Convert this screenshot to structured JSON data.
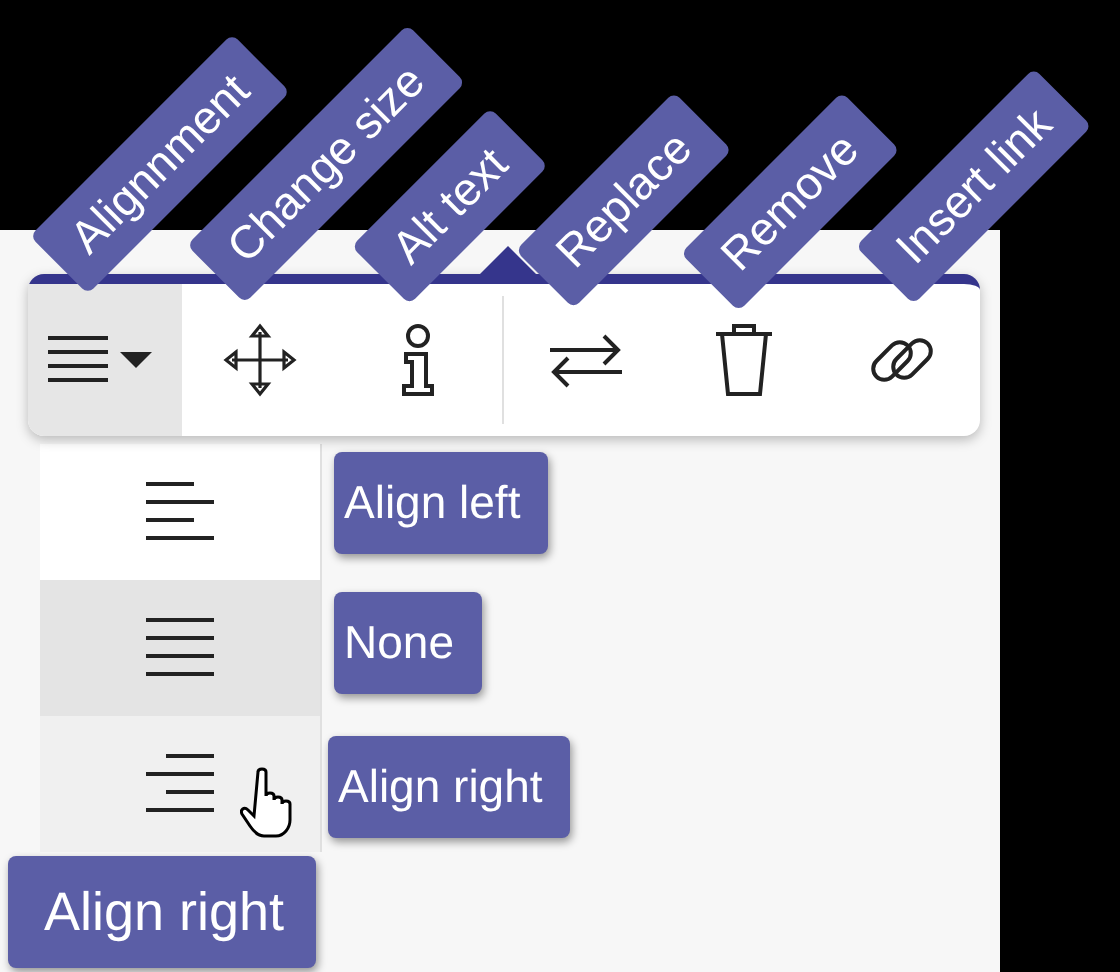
{
  "toolbar_labels": [
    {
      "label": "Alignnment"
    },
    {
      "label": "Change size"
    },
    {
      "label": "Alt text"
    },
    {
      "label": "Replace"
    },
    {
      "label": "Remove"
    },
    {
      "label": "Insert link"
    }
  ],
  "toolbar": {
    "buttons": [
      {
        "kind": "alignment",
        "pressed": true
      },
      {
        "kind": "move",
        "pressed": false
      },
      {
        "kind": "info",
        "pressed": false
      },
      {
        "kind": "replace",
        "pressed": false
      },
      {
        "kind": "delete",
        "pressed": false
      },
      {
        "kind": "link",
        "pressed": false
      }
    ]
  },
  "alignment_menu": {
    "options": [
      {
        "kind": "left",
        "tooltip": "Align left",
        "selected": false,
        "hovered": false
      },
      {
        "kind": "none",
        "tooltip": "None",
        "selected": true,
        "hovered": false
      },
      {
        "kind": "right",
        "tooltip": "Align right",
        "selected": false,
        "hovered": true
      }
    ]
  },
  "cursor_tooltip": "Align right"
}
